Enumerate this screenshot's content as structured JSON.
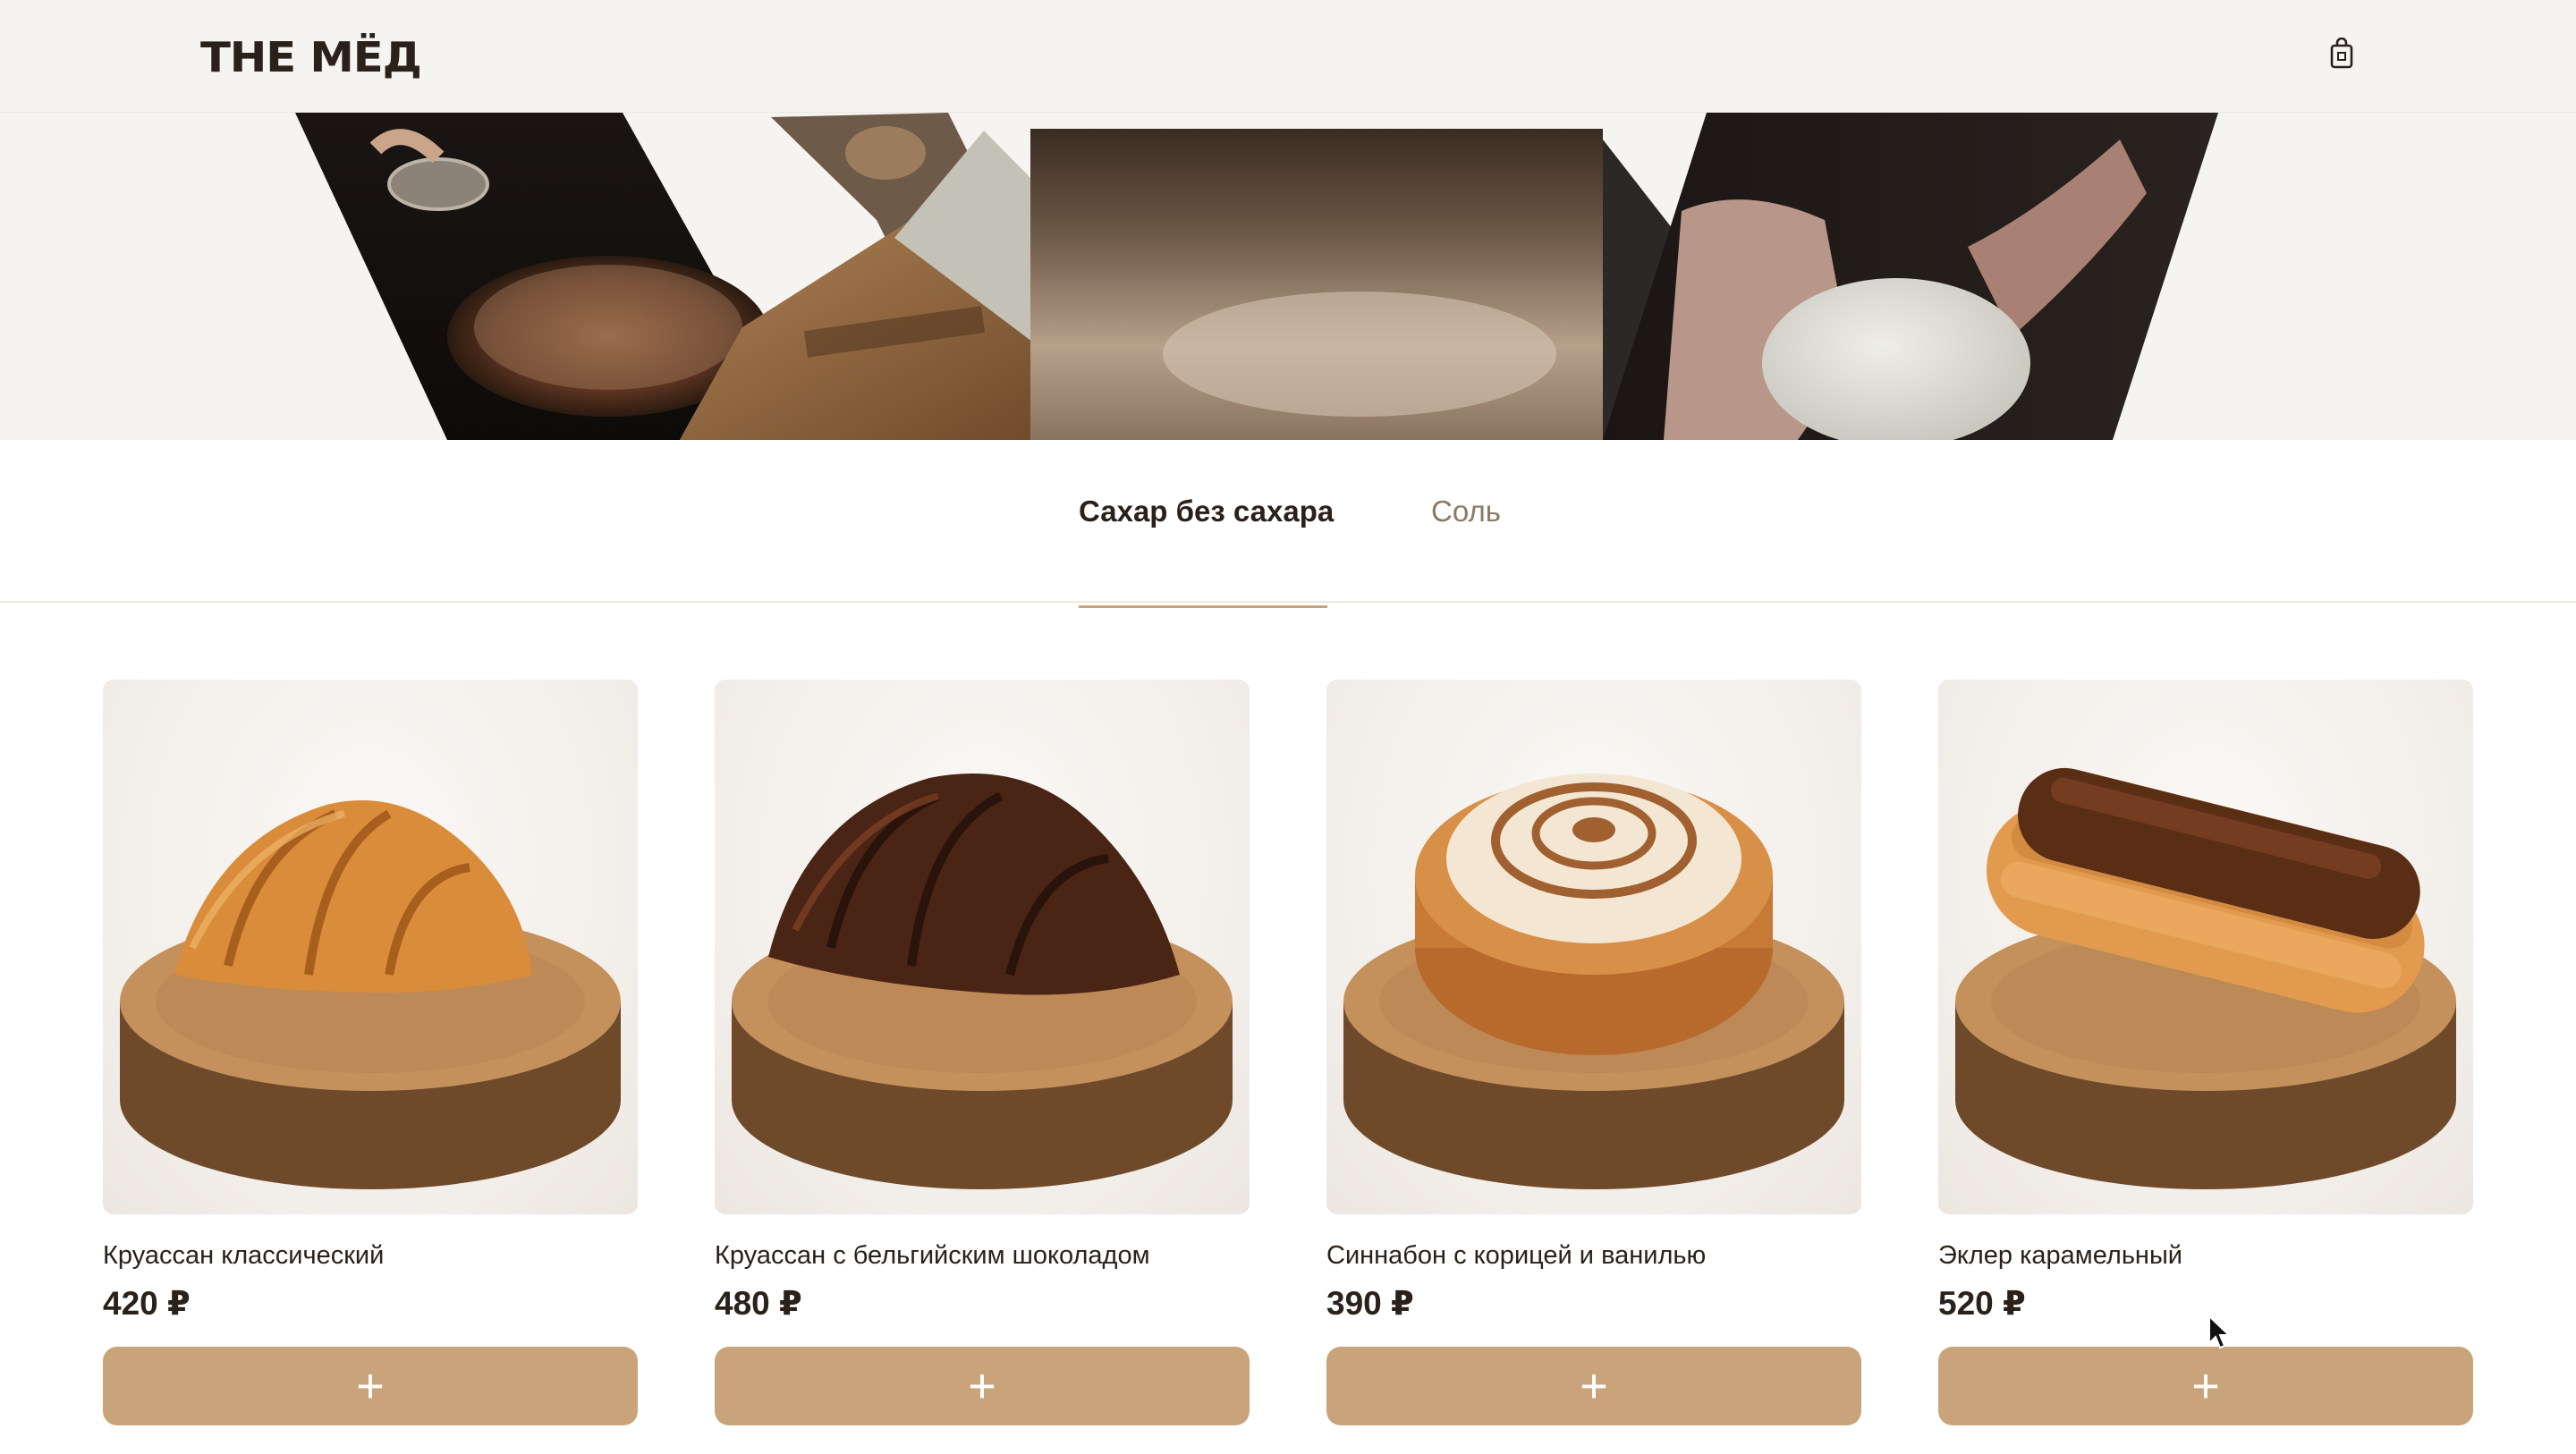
{
  "header": {
    "logo": "THE МЁД",
    "cart_icon": "shopping-bag-icon"
  },
  "tabs": [
    {
      "label": "Сахар без сахара",
      "active": true
    },
    {
      "label": "Соль",
      "active": false
    }
  ],
  "products": [
    {
      "name": "Круассан классический",
      "price": "420 ₽",
      "add_label": "+"
    },
    {
      "name": "Круассан с бельгийским шоколадом",
      "price": "480 ₽",
      "add_label": "+"
    },
    {
      "name": "Синнабон с корицей и ванилью",
      "price": "390 ₽",
      "add_label": "+"
    },
    {
      "name": "Эклер карамельный",
      "price": "520 ₽",
      "add_label": "+"
    }
  ],
  "colors": {
    "accent": "#c9a47b",
    "text": "#2a211b",
    "muted": "#8a7a63",
    "header_bg": "#f6f4f0"
  }
}
